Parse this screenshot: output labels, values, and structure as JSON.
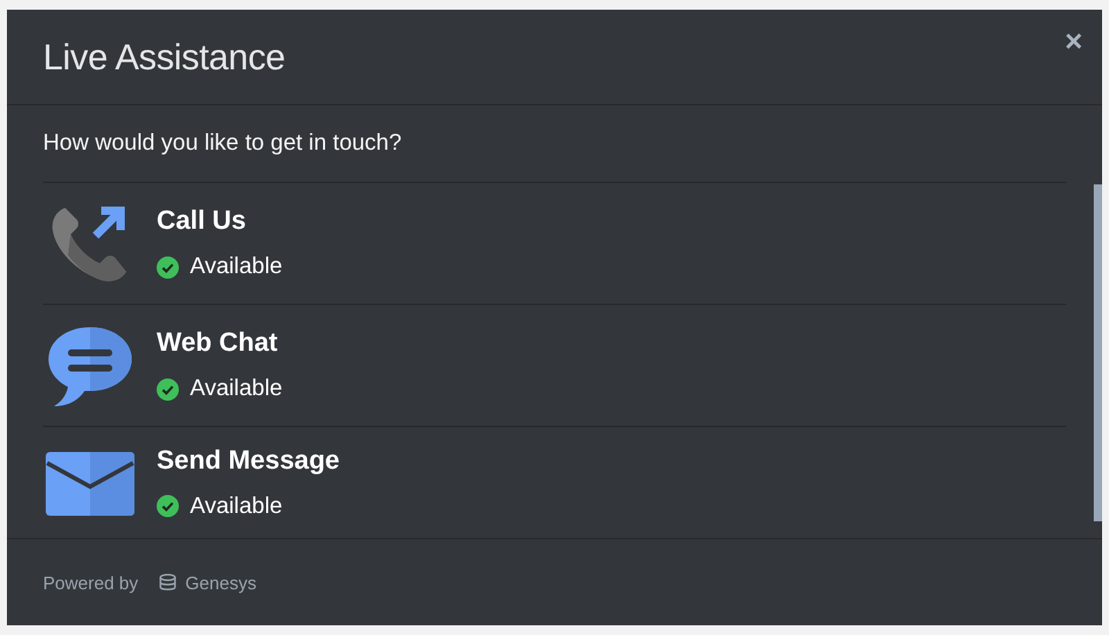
{
  "dialog": {
    "title": "Live Assistance",
    "close": "×"
  },
  "prompt": "How would you like to get in touch?",
  "options": [
    {
      "kind": "phone",
      "label": "Call Us",
      "status": "Available",
      "available": true
    },
    {
      "kind": "chat",
      "label": "Web Chat",
      "status": "Available",
      "available": true
    },
    {
      "kind": "email",
      "label": "Send Message",
      "status": "Available",
      "available": true
    }
  ],
  "footer": {
    "powered_by": "Powered by",
    "brand": "Genesys"
  }
}
